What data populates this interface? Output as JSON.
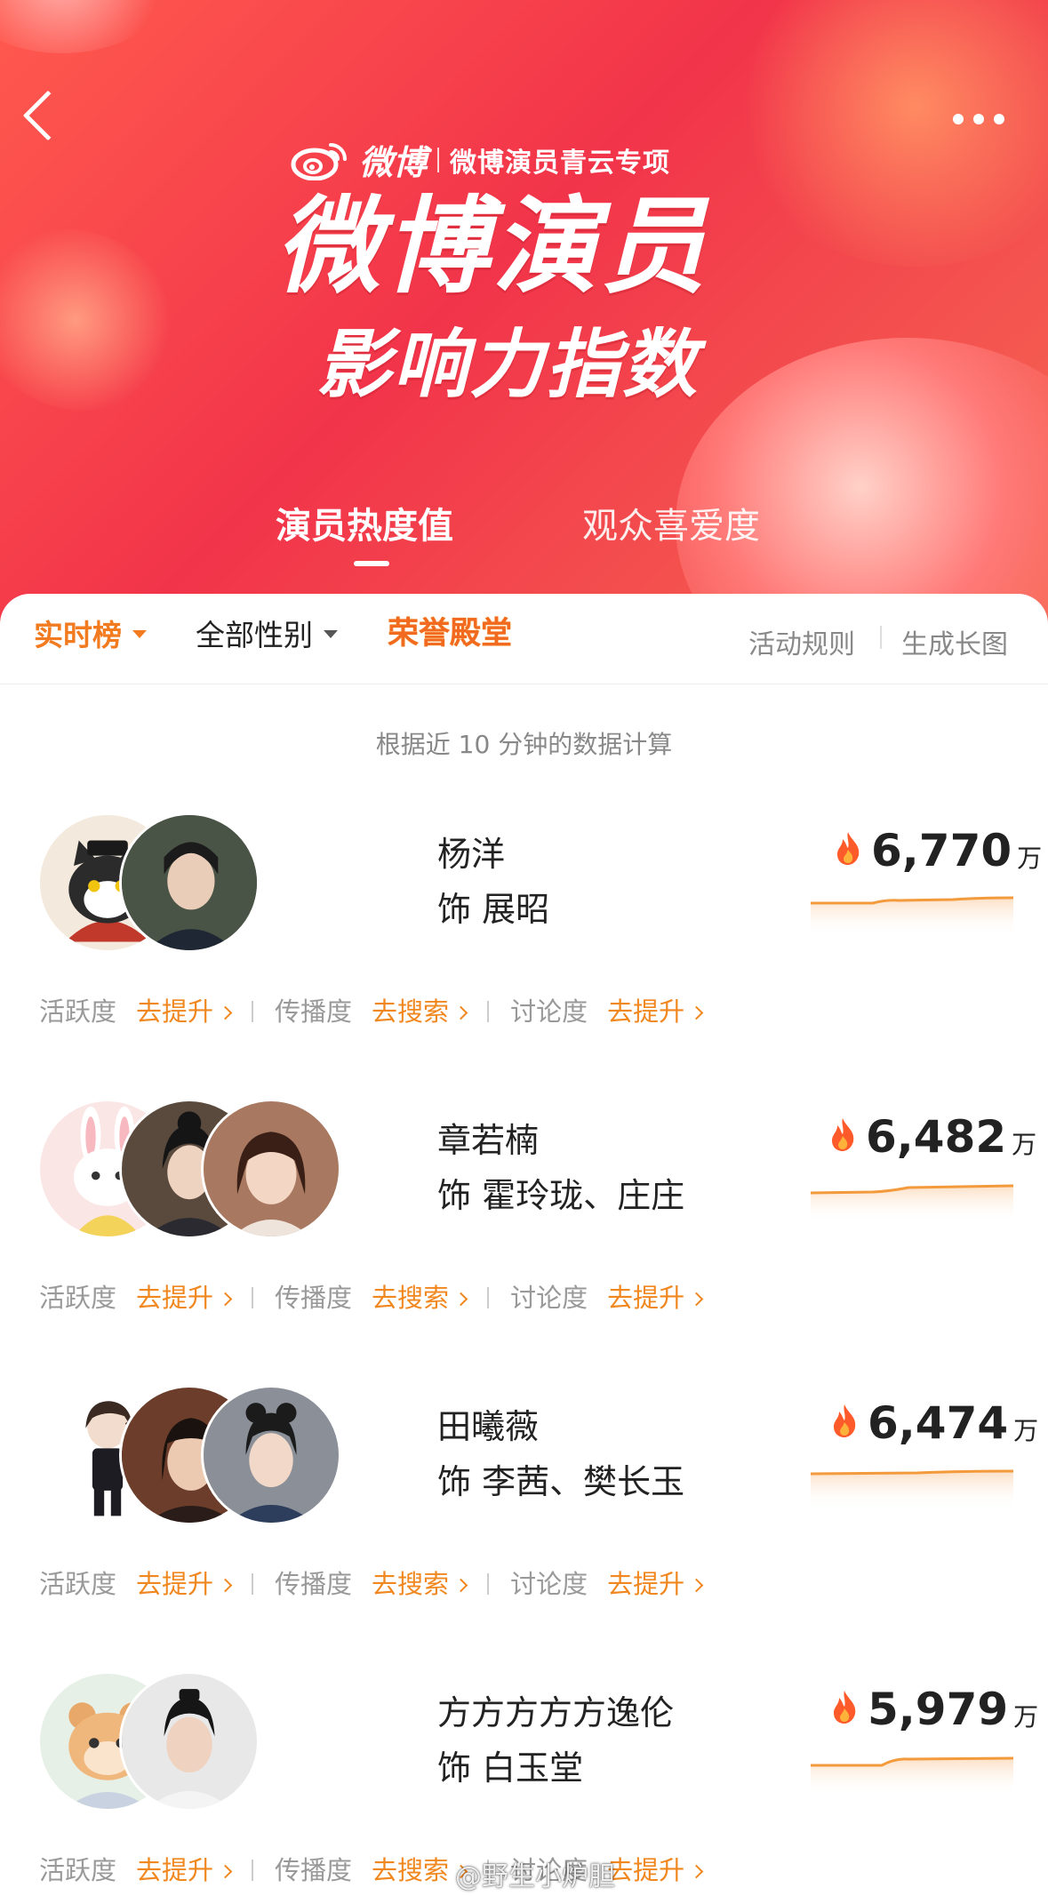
{
  "header": {
    "brand_name": "微博",
    "brand_subtitle": "微博演员青云专项",
    "title_line1": "微博演员",
    "title_line2": "影响力指数",
    "tabs": [
      {
        "label": "演员热度值",
        "active": true
      },
      {
        "label": "观众喜爱度",
        "active": false
      }
    ]
  },
  "filters": {
    "realtime": "实时榜",
    "gender": "全部性别",
    "hall_of_fame": "荣誉殿堂",
    "rules": "活动规则",
    "long_image": "生成长图"
  },
  "note": "根据近 10 分钟的数据计算",
  "action_labels": {
    "activity": "活跃度",
    "spread": "传播度",
    "discussion": "讨论度"
  },
  "cards": [
    {
      "name": "杨洋",
      "role": "饰 展昭",
      "score": "6,770",
      "unit": "万",
      "actions": [
        "去提升",
        "去搜索",
        "去提升"
      ],
      "avatars": [
        "cartoon-cat",
        "actor-photo"
      ]
    },
    {
      "name": "章若楠",
      "role": "饰 霍玲珑、庄庄",
      "score": "6,482",
      "unit": "万",
      "actions": [
        "去提升",
        "去搜索",
        "去提升"
      ],
      "avatars": [
        "cartoon-rabbit",
        "actor-photo",
        "actor-photo"
      ]
    },
    {
      "name": "田曦薇",
      "role": "饰 李茜、樊长玉",
      "score": "6,474",
      "unit": "万",
      "actions": [
        "去提升",
        "去搜索",
        "去提升"
      ],
      "avatars": [
        "chibi-figure",
        "actor-photo",
        "actor-photo"
      ]
    },
    {
      "name": "方方方方方逸伦",
      "role": "饰 白玉堂",
      "score": "5,979",
      "unit": "万",
      "actions": [
        "去提升",
        "去搜索",
        "去提升"
      ],
      "avatars": [
        "cartoon-hamster",
        "actor-photo"
      ]
    }
  ],
  "watermark": "@野生小炉胆",
  "colors": {
    "hero_red": "#f2344a",
    "accent_orange": "#f0871f",
    "text_dark": "#222222",
    "text_gray": "#999999"
  }
}
